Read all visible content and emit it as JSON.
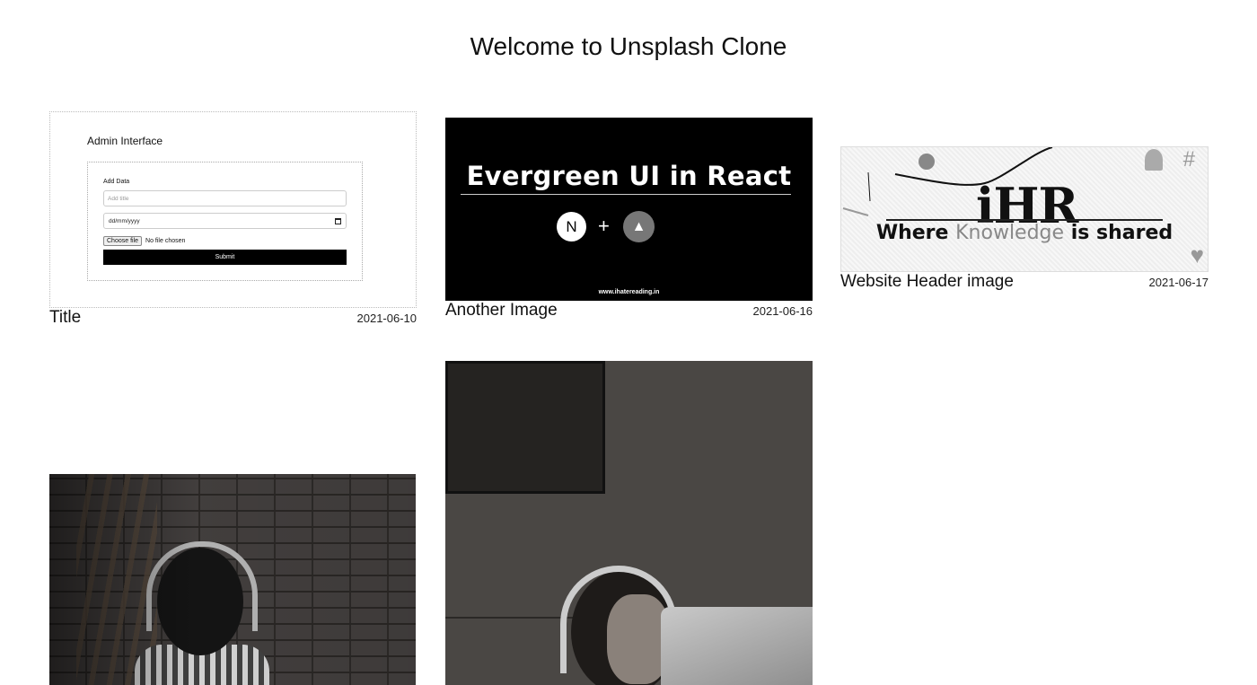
{
  "page": {
    "title": "Welcome to Unsplash Clone"
  },
  "cards": [
    {
      "caption": "Title",
      "date": "2021-06-10",
      "admin": {
        "heading": "Admin Interface",
        "form_label": "Add Data",
        "title_placeholder": "Add title",
        "date_value": "dd/mm/yyyy",
        "file_button": "Choose file",
        "file_status": "No file chosen",
        "submit": "Submit"
      }
    },
    {
      "caption": "Another Image",
      "date": "2021-06-16",
      "banner": {
        "title": "Evergreen UI in React",
        "left_icon": "N",
        "plus": "+",
        "url": "www.ihatereading.in"
      }
    },
    {
      "caption": "Website Header image",
      "date": "2021-06-17",
      "header": {
        "logo": "iHR",
        "tagline_1": "Where",
        "tagline_2": "Knowledge",
        "tagline_3": "is shared",
        "hash": "#"
      }
    },
    {
      "caption": "",
      "date": ""
    },
    {
      "caption": "",
      "date": ""
    }
  ],
  "icons": [
    "nextjs-icon",
    "evergreen-tree-icon",
    "hashtag-icon",
    "heart-icon",
    "calendar-icon"
  ]
}
